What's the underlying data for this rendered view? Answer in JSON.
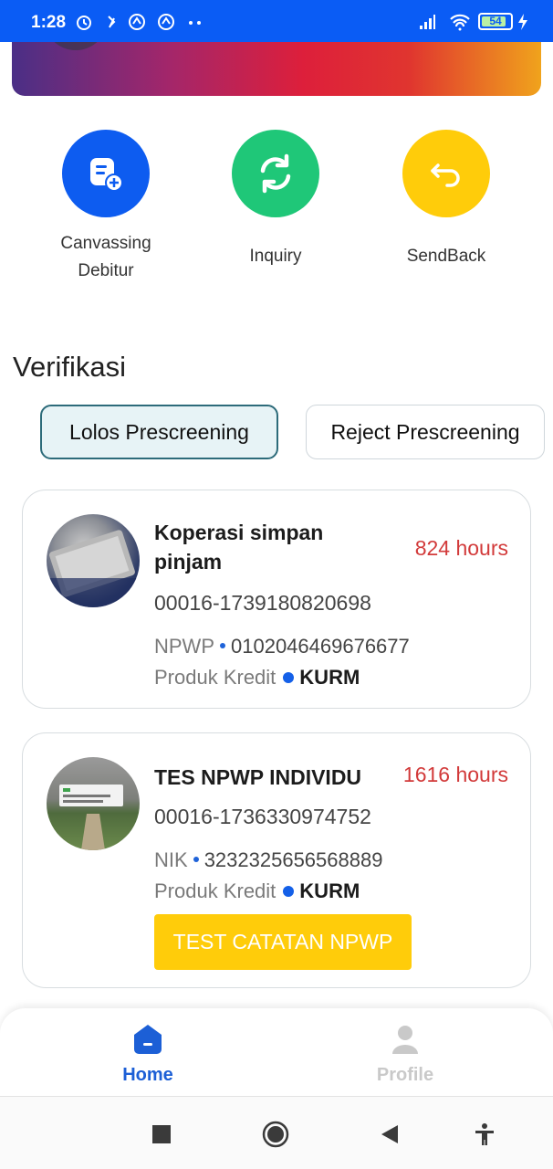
{
  "status_bar": {
    "time": "1:28",
    "battery": "54"
  },
  "actions": [
    {
      "label": "Canvassing\nDebitur",
      "color": "#0d5cf0",
      "icon": "document-add-icon"
    },
    {
      "label": "Inquiry",
      "color": "#1fc778",
      "icon": "refresh-icon"
    },
    {
      "label": "SendBack",
      "color": "#ffcc0a",
      "icon": "return-arrow-icon"
    }
  ],
  "section_title": "Verifikasi",
  "filters": {
    "active": "Lolos Prescreening",
    "inactive": "Reject Prescreening"
  },
  "cards": [
    {
      "title": "Koperasi simpan pinjam",
      "hours": "824 hours",
      "app_no": "00016-1739180820698",
      "id_label": "NPWP",
      "id_value": "0102046469676677",
      "produk_label": "Produk Kredit",
      "produk_value": "KURM"
    },
    {
      "title": "TES NPWP INDIVIDU",
      "hours": "1616 hours",
      "app_no": "00016-1736330974752",
      "id_label": "NIK",
      "id_value": "3232325656568889",
      "produk_label": "Produk Kredit",
      "produk_value": "KURM",
      "note": "TEST CATATAN NPWP"
    }
  ],
  "bottom_nav": {
    "home": "Home",
    "profile": "Profile",
    "active_color": "#1c5fd6",
    "inactive_color": "#c9c9c9"
  }
}
